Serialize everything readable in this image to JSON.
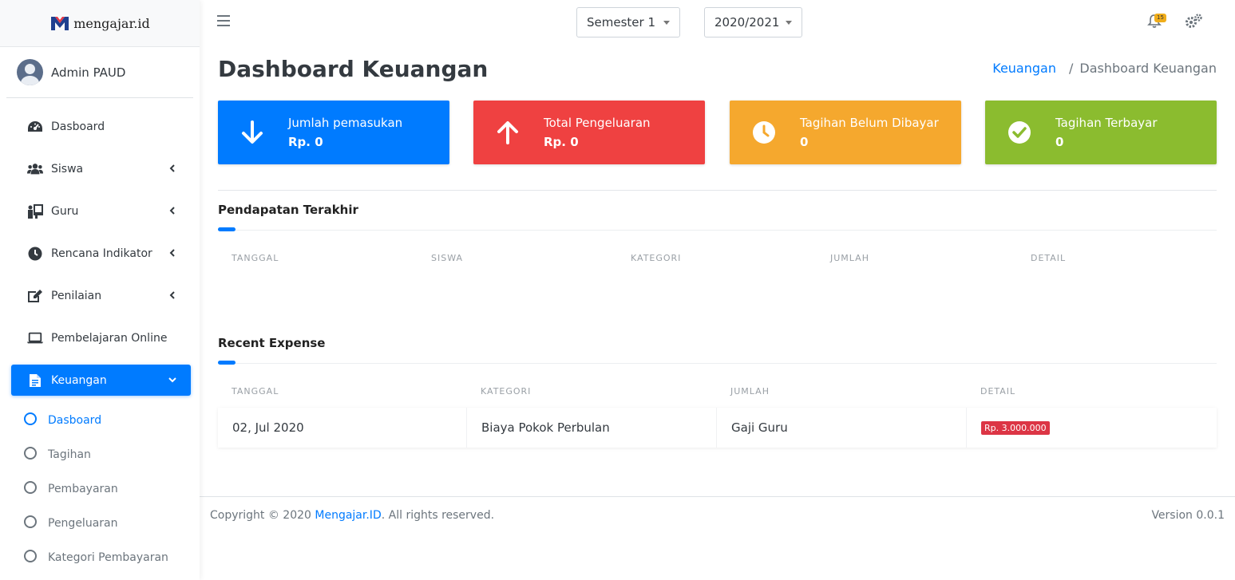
{
  "brand": {
    "name": "mengajar.id"
  },
  "user": {
    "name": "Admin PAUD"
  },
  "sidebar": {
    "items": [
      {
        "label": "Dasboard",
        "icon": "dashboard-icon",
        "has_caret": false
      },
      {
        "label": "Siswa",
        "icon": "users-icon",
        "has_caret": true
      },
      {
        "label": "Guru",
        "icon": "teacher-icon",
        "has_caret": true
      },
      {
        "label": "Rencana Indikator",
        "icon": "clock-icon",
        "has_caret": true
      },
      {
        "label": "Penilaian",
        "icon": "edit-icon",
        "has_caret": true
      },
      {
        "label": "Pembelajaran Online",
        "icon": "laptop-icon",
        "has_caret": false
      },
      {
        "label": "Keuangan",
        "icon": "file-invoice-icon",
        "has_caret": true,
        "active": true
      }
    ],
    "subitems": [
      {
        "label": "Dasboard",
        "active": true
      },
      {
        "label": "Tagihan"
      },
      {
        "label": "Pembayaran"
      },
      {
        "label": "Pengeluaran"
      },
      {
        "label": "Kategori Pembayaran"
      }
    ]
  },
  "topbar": {
    "semester": "Semester 1",
    "year": "2020/2021",
    "notification_count": "15"
  },
  "page": {
    "title": "Dashboard Keuangan",
    "breadcrumb": {
      "parent": "Keuangan",
      "separator": "/",
      "current": "Dashboard Keuangan"
    }
  },
  "info_boxes": [
    {
      "label": "Jumlah pemasukan",
      "value": "Rp. 0",
      "color": "#007bff",
      "icon": "arrow-down-icon"
    },
    {
      "label": "Total Pengeluaran",
      "value": "Rp. 0",
      "color": "#ef4141",
      "icon": "arrow-up-icon"
    },
    {
      "label": "Tagihan Belum Dibayar",
      "value": "0",
      "color": "#f5a82e",
      "icon": "clock-icon"
    },
    {
      "label": "Tagihan Terbayar",
      "value": "0",
      "color": "#8bbc2f",
      "icon": "check-circle-icon"
    }
  ],
  "income": {
    "title": "Pendapatan Terakhir",
    "columns": [
      "TANGGAL",
      "SISWA",
      "KATEGORI",
      "JUMLAH",
      "DETAIL"
    ]
  },
  "expense": {
    "title": "Recent Expense",
    "columns": [
      "TANGGAL",
      "KATEGORI",
      "JUMLAH",
      "DETAIL"
    ],
    "rows": [
      {
        "tanggal": "02, Jul 2020",
        "kategori": "Biaya Pokok Perbulan",
        "jumlah": "Gaji Guru",
        "detail": "Rp. 3.000.000"
      }
    ]
  },
  "footer": {
    "copyright_prefix": "Copyright © 2020",
    "brand_link": "Mengajar.ID",
    "copyright_suffix": ". All rights reserved.",
    "version": "Version 0.0.1"
  }
}
